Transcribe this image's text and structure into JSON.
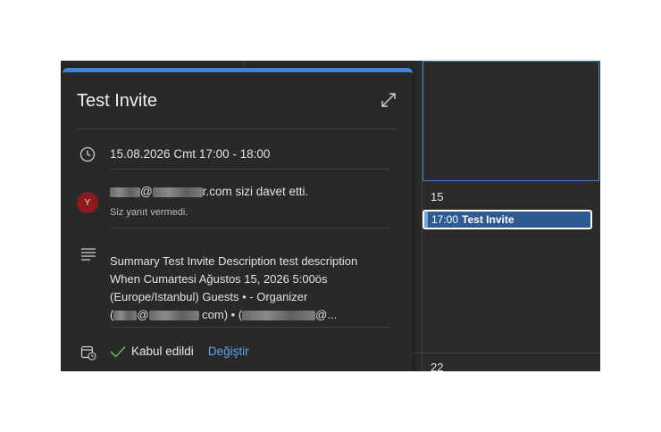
{
  "popup": {
    "title": "Test Invite",
    "datetime": "15.08.2026 Cmt 17:00 - 18:00",
    "organizer_initial": "Y",
    "invited_text_suffix": "r.com sizi davet etti.",
    "invited_at": "@",
    "response_status": "Siz yanıt vermedi.",
    "description": {
      "line1": "Summary Test Invite Description test description",
      "line2": "When Cumartesi Ağustos 15, 2026 5:00ös",
      "line3": "(Europe/Istanbul) Guests • - Organizer",
      "line4_a": "(",
      "line4_at": "@",
      "line4_b": "com) • (",
      "line4_c": "@..."
    },
    "accepted_label": "Kabul edildi",
    "change_label": "Değiştir"
  },
  "calendar": {
    "day_15": "15",
    "day_22": "22",
    "event": {
      "time": "17:00",
      "title": "Test Invite"
    }
  },
  "colors": {
    "accent": "#3f83d1",
    "link": "#5aa2f0",
    "event_bg": "#2d5a93",
    "avatar": "#8c1c1c"
  },
  "icons": [
    "clock-icon",
    "expand-icon",
    "notes-icon",
    "calendar-status-icon",
    "check-icon"
  ]
}
